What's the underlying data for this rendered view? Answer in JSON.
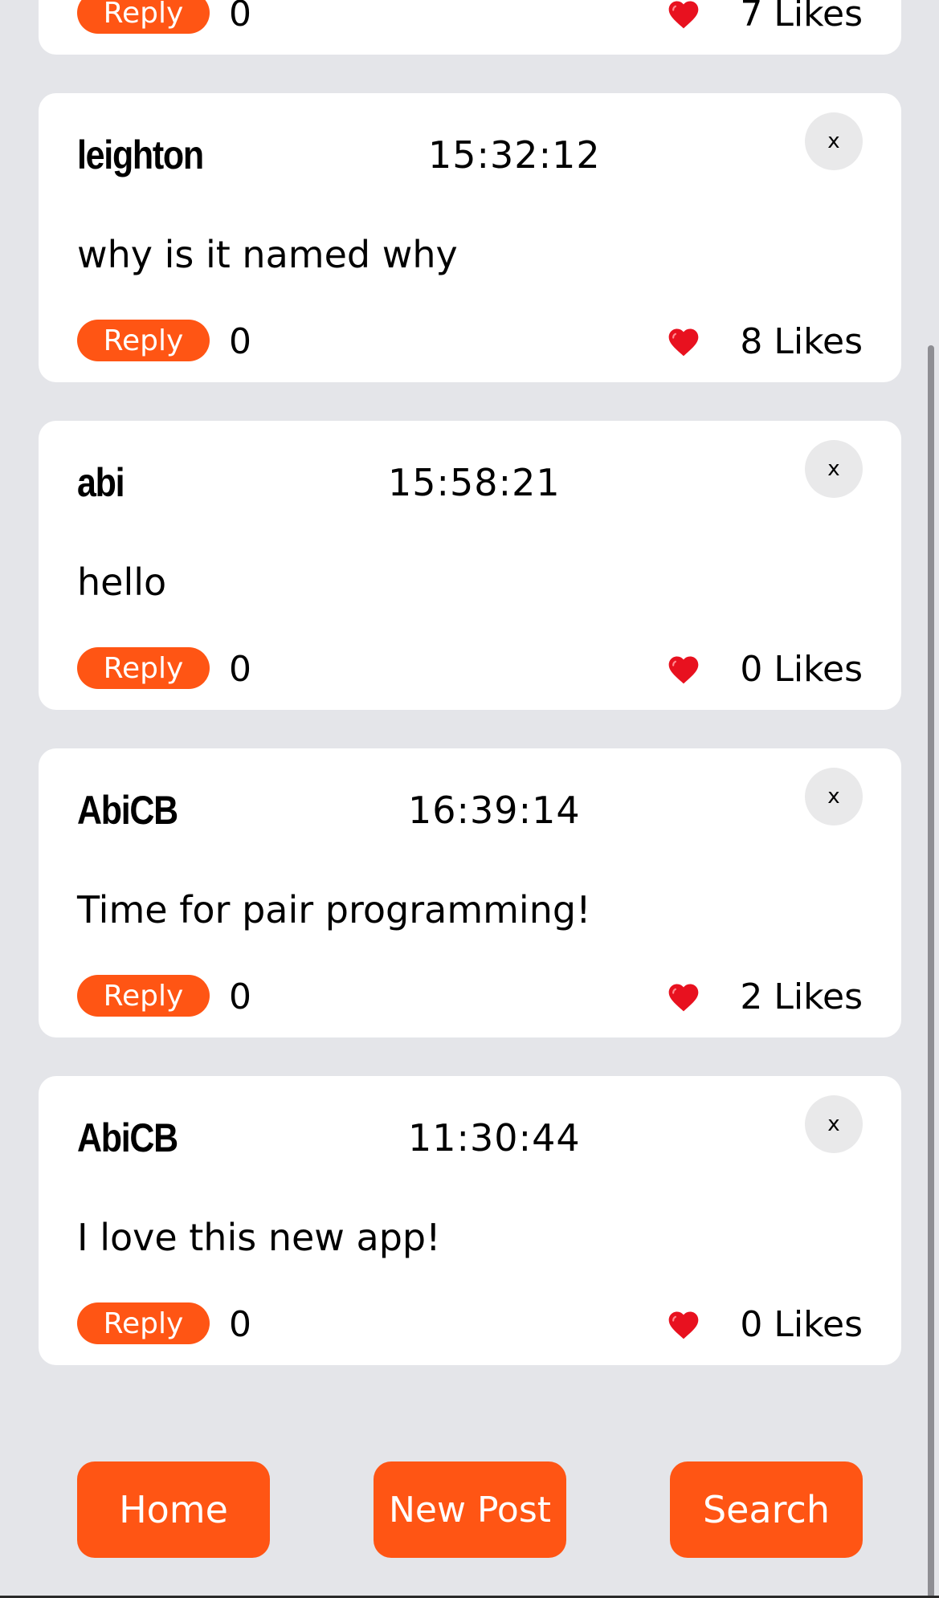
{
  "accent_color": "#ff5514",
  "posts": [
    {
      "username": "",
      "time": "",
      "message": "",
      "reply_label": "Reply",
      "reply_count": "0",
      "likes": "7 Likes",
      "close_label": ""
    },
    {
      "username": "leighton",
      "time": "15:32:12",
      "message": "why is it named why",
      "reply_label": "Reply",
      "reply_count": "0",
      "likes": "8 Likes",
      "close_label": "x"
    },
    {
      "username": "abi",
      "time": "15:58:21",
      "message": "hello",
      "reply_label": "Reply",
      "reply_count": "0",
      "likes": "0 Likes",
      "close_label": "x"
    },
    {
      "username": "AbiCB",
      "time": "16:39:14",
      "message": "Time for pair programming!",
      "reply_label": "Reply",
      "reply_count": "0",
      "likes": "2 Likes",
      "close_label": "x"
    },
    {
      "username": "AbiCB",
      "time": "11:30:44",
      "message": "I love this new app!",
      "reply_label": "Reply",
      "reply_count": "0",
      "likes": "0 Likes",
      "close_label": "x"
    }
  ],
  "nav": {
    "home_label": "Home",
    "new_post_label": "New Post",
    "search_label": "Search"
  },
  "icons": {
    "like": "heart-icon",
    "close": "close-icon"
  }
}
